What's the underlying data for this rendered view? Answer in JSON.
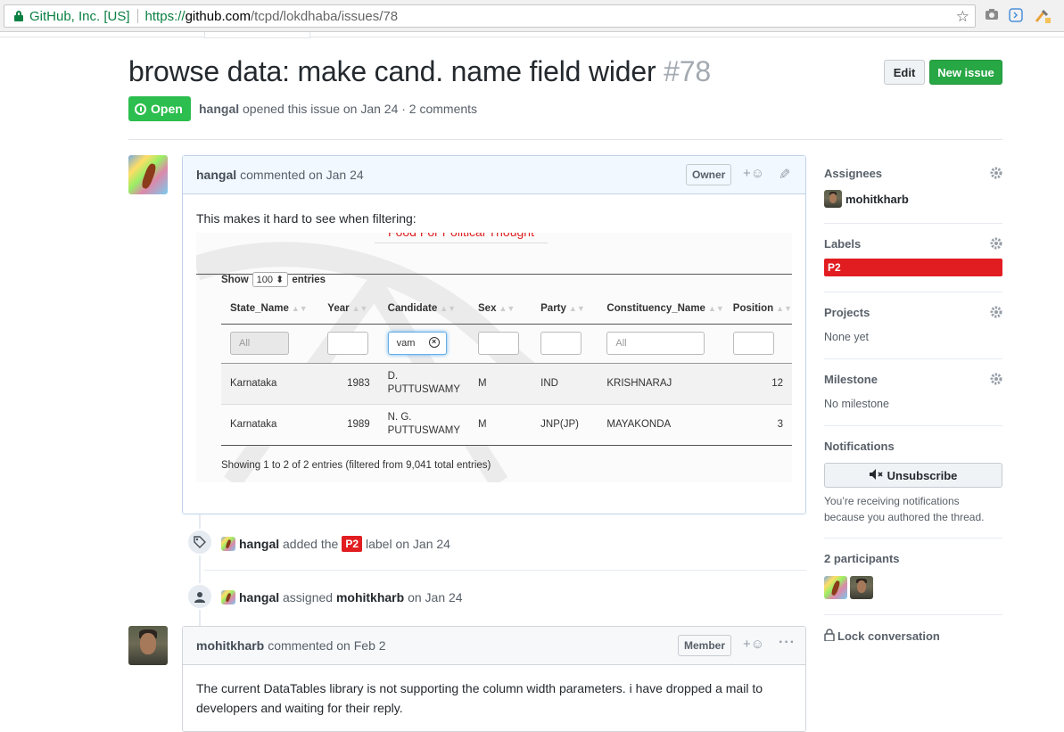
{
  "browser": {
    "secure_label": "GitHub, Inc. [US]",
    "url_scheme": "https://",
    "url_host": "github.com",
    "url_path": "/tcpd/lokdhaba/issues/78"
  },
  "issue": {
    "title": "browse data: make cand. name field wider",
    "number": "#78",
    "state": "Open",
    "author": "hangal",
    "opened_text": "opened this issue on Jan 24 · 2 comments",
    "edit_label": "Edit",
    "new_issue_label": "New issue"
  },
  "comments": [
    {
      "author": "hangal",
      "action": "commented on Jan 24",
      "role": "Owner",
      "body": "This makes it hard to see when filtering:"
    },
    {
      "author": "mohitkharb",
      "action": "commented on Feb 2",
      "role": "Member",
      "body": "The current DataTables library is not supporting the column width parameters. i have dropped a mail to developers and waiting for their reply."
    }
  ],
  "reaction_symbol": "+☺",
  "embedded_table": {
    "cut_title": "Food For Political Thought",
    "show_prefix": "Show",
    "show_value": "100",
    "show_suffix": "entries",
    "columns": [
      "State_Name",
      "Year",
      "Candidate",
      "Sex",
      "Party",
      "Constituency_Name",
      "Position"
    ],
    "filters": {
      "state": "All",
      "candidate": "vam",
      "constituency": "All"
    },
    "rows": [
      {
        "state": "Karnataka",
        "year": "1983",
        "candidate_1": "D.",
        "candidate_2": "PUTTUSWAMY",
        "sex": "M",
        "party": "IND",
        "constituency": "KRISHNARAJ",
        "position": "12"
      },
      {
        "state": "Karnataka",
        "year": "1989",
        "candidate_1": "N. G.",
        "candidate_2": "PUTTUSWAMY",
        "sex": "M",
        "party": "JNP(JP)",
        "constituency": "MAYAKONDA",
        "position": "3"
      }
    ],
    "info": "Showing 1 to 2 of 2 entries (filtered from 9,041 total entries)"
  },
  "events": [
    {
      "actor": "hangal",
      "pre": "added the",
      "label": "P2",
      "post": "label on Jan 24"
    },
    {
      "actor": "hangal",
      "pre": "assigned",
      "target": "mohitkharb",
      "post": "on Jan 24"
    }
  ],
  "sidebar": {
    "assignees_title": "Assignees",
    "assignee": "mohitkharb",
    "labels_title": "Labels",
    "label": "P2",
    "label_color": "#e11d21",
    "projects_title": "Projects",
    "projects_value": "None yet",
    "milestone_title": "Milestone",
    "milestone_value": "No milestone",
    "notifications_title": "Notifications",
    "unsubscribe_label": "Unsubscribe",
    "notif_line1": "You’re receiving notifications",
    "notif_line2": "because you authored the thread.",
    "participants_title": "2 participants",
    "lock_label": "Lock conversation"
  },
  "colors": {
    "open_green": "#2cbe4e",
    "new_issue_green": "#28a745",
    "p2_red": "#e11d21"
  }
}
